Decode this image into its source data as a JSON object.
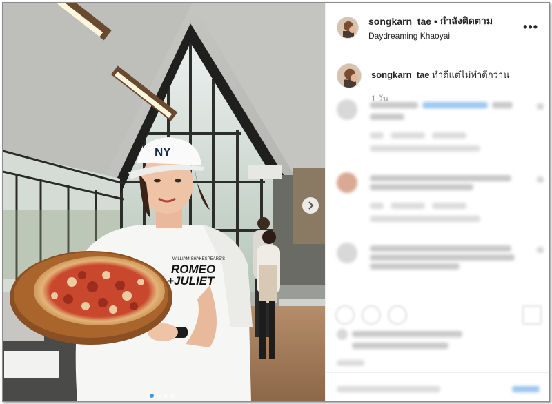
{
  "post": {
    "username": "songkarn_tae",
    "separator": "•",
    "follow_label": "กำลังติดตาม",
    "location": "Daydreaming Khaoyai",
    "more_icon": "more-options-icon"
  },
  "caption": {
    "username": "songkarn_tae",
    "text": "ทำดีแต่ไม่ทำดีกว่าน",
    "time": "1 วัน"
  },
  "photo": {
    "slide_count": 4,
    "active_slide": 1,
    "shirt_text_small": "WILLIAM SHAKESPEARE'S",
    "shirt_text_main": "ROMEO",
    "shirt_text_main2": "+JULIET",
    "cap_logo": "NY"
  },
  "colors": {
    "accent": "#3897f0",
    "divider": "#efefef"
  }
}
